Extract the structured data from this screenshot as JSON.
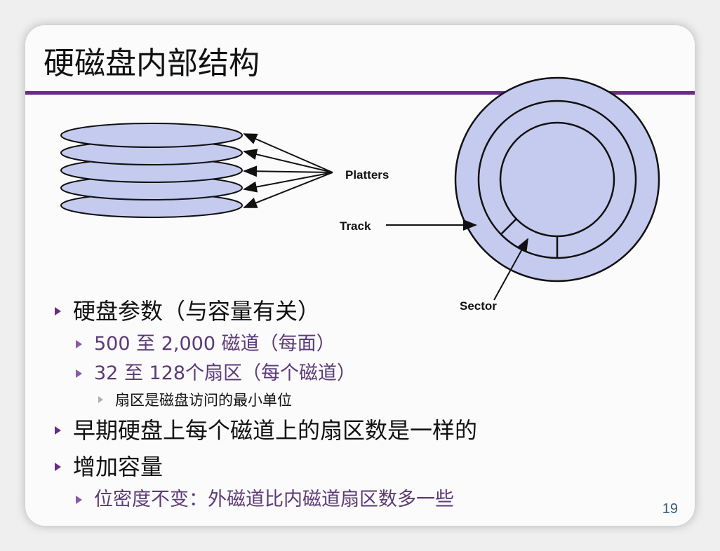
{
  "slide": {
    "title": "硬磁盘内部结构",
    "page_number": "19",
    "accent_color": "#6a2c86",
    "platter_color": "#c5cbef"
  },
  "diagram": {
    "platters_label": "Platters",
    "track_label": "Track",
    "sector_label": "Sector"
  },
  "bullets": [
    {
      "level": 1,
      "text": "硬盘参数（与容量有关）"
    },
    {
      "level": 2,
      "text": "500 至 2,000 磁道（每面）"
    },
    {
      "level": 2,
      "text": "32 至 128个扇区（每个磁道）"
    },
    {
      "level": 3,
      "text": "扇区是磁盘访问的最小单位"
    },
    {
      "level": 1,
      "text": "早期硬盘上每个磁道上的扇区数是一样的"
    },
    {
      "level": 1,
      "text": "增加容量"
    },
    {
      "level": 2,
      "text": "位密度不变：外磁道比内磁道扇区数多一些"
    }
  ]
}
